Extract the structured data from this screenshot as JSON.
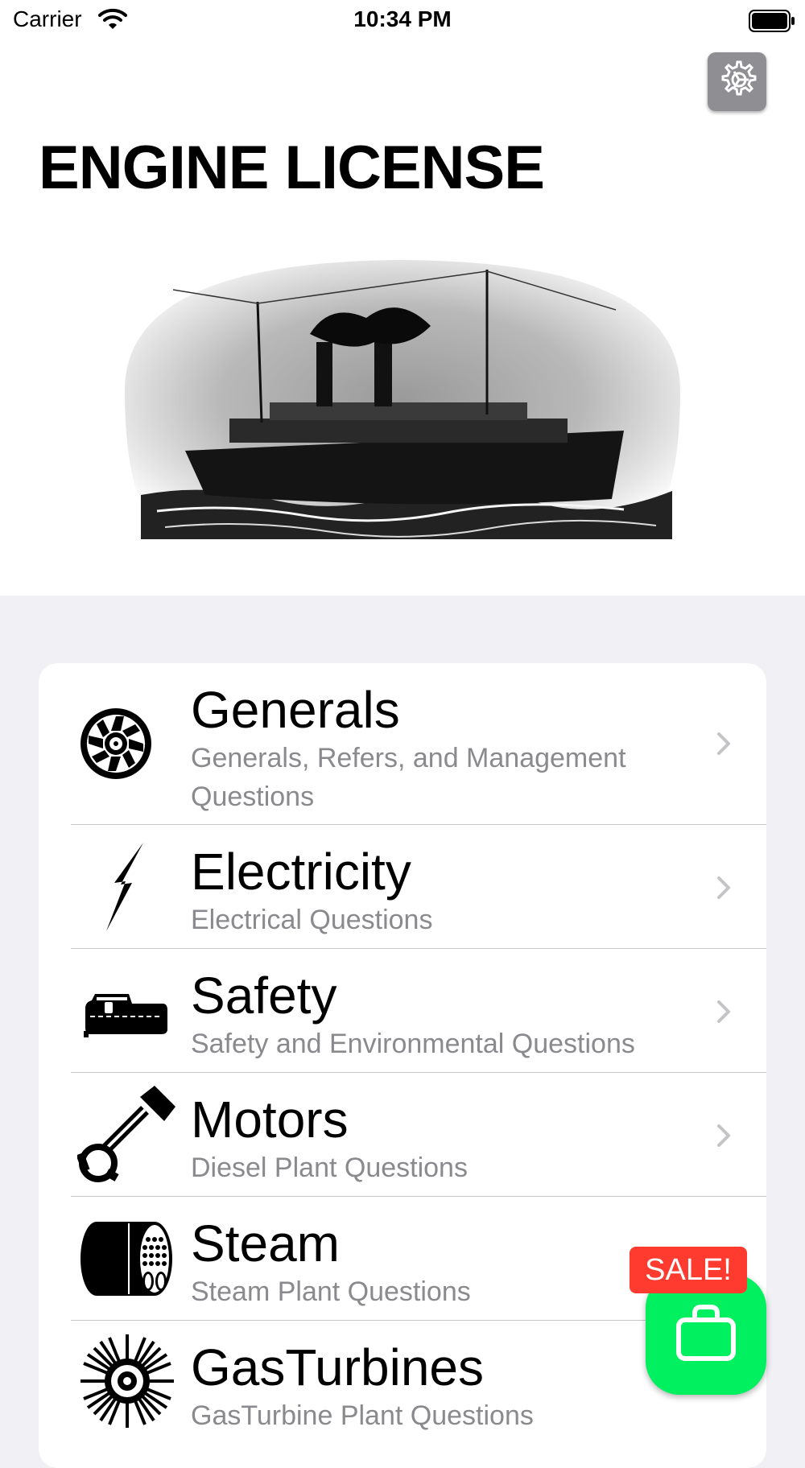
{
  "status_bar": {
    "carrier": "Carrier",
    "time": "10:34 PM"
  },
  "header": {
    "title": "ENGINE LICENSE",
    "settings_icon": "gear-icon"
  },
  "menu": {
    "items": [
      {
        "title": "Generals",
        "subtitle": "Generals, Refers, and Management Questions",
        "icon": "wheel-icon"
      },
      {
        "title": "Electricity",
        "subtitle": "Electrical Questions",
        "icon": "lightning-bolt-icon"
      },
      {
        "title": "Safety",
        "subtitle": "Safety and Environmental Questions",
        "icon": "lifeboat-icon"
      },
      {
        "title": "Motors",
        "subtitle": "Diesel Plant Questions",
        "icon": "piston-icon"
      },
      {
        "title": "Steam",
        "subtitle": "Steam Plant Questions",
        "icon": "boiler-icon"
      },
      {
        "title": "GasTurbines",
        "subtitle": "GasTurbine Plant Questions",
        "icon": "turbine-icon"
      }
    ]
  },
  "sale": {
    "badge": "SALE!",
    "icon": "shopping-bag-icon",
    "color": "#00f060",
    "badge_color": "#ff3b30"
  }
}
